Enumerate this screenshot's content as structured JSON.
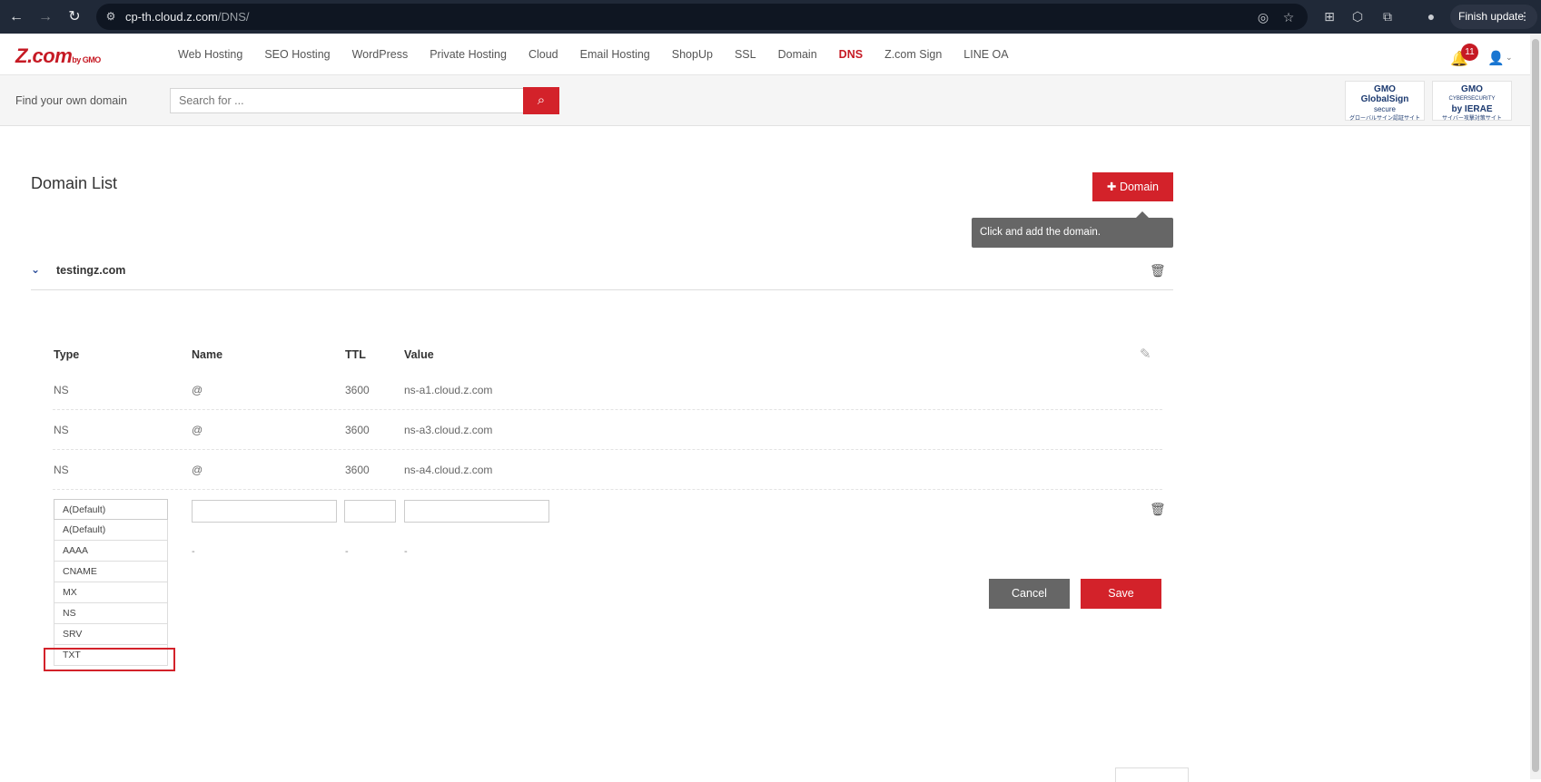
{
  "browser": {
    "url_host": "cp-th.cloud.z.com",
    "url_path": "/DNS/",
    "finish_update_label": "Finish update"
  },
  "header": {
    "logo_text": "Z.com",
    "logo_by": "by GMO",
    "menu": [
      {
        "label": "Web Hosting"
      },
      {
        "label": "SEO Hosting"
      },
      {
        "label": "WordPress"
      },
      {
        "label": "Private Hosting"
      },
      {
        "label": "Cloud"
      },
      {
        "label": "Email Hosting"
      },
      {
        "label": "ShopUp"
      },
      {
        "label": "SSL"
      },
      {
        "label": "Domain"
      },
      {
        "label": "DNS"
      },
      {
        "label": "Z.com Sign"
      },
      {
        "label": "LINE OA"
      }
    ],
    "active_menu": "DNS",
    "notification_count": "11"
  },
  "search": {
    "label": "Find your own domain",
    "placeholder": "Search for ..."
  },
  "seals": {
    "globalsign_line1": "GMO",
    "globalsign_line2": "GlobalSign",
    "globalsign_line3": "secure",
    "globalsign_line4": "グローバルサイン認証サイト",
    "ierae_line1": "GMO",
    "ierae_line2": "CYBERSECURITY",
    "ierae_line3": "by IERAE",
    "ierae_line4": "サイバー攻撃対策サイト"
  },
  "main": {
    "title": "Domain List",
    "add_domain_label": "Domain",
    "tooltip": "Click and add the domain.",
    "domain": "testingz.com",
    "columns": {
      "type": "Type",
      "name": "Name",
      "ttl": "TTL",
      "value": "Value"
    },
    "records": [
      {
        "type": "NS",
        "name": "@",
        "ttl": "3600",
        "value": "ns-a1.cloud.z.com"
      },
      {
        "type": "NS",
        "name": "@",
        "ttl": "3600",
        "value": "ns-a3.cloud.z.com"
      },
      {
        "type": "NS",
        "name": "@",
        "ttl": "3600",
        "value": "ns-a4.cloud.z.com"
      }
    ],
    "new_record": {
      "selected_type": "A(Default)",
      "type_options": [
        "A(Default)",
        "AAAA",
        "CNAME",
        "MX",
        "NS",
        "SRV",
        "TXT"
      ],
      "highlighted_option": "TXT",
      "name_value": "",
      "ttl_value": "",
      "value_value": "",
      "placeholder_dash": "-"
    },
    "cancel_label": "Cancel",
    "save_label": "Save"
  },
  "colors": {
    "brand_red": "#d3222a",
    "chrome_bg": "#202938",
    "cancel_gray": "#666666"
  }
}
